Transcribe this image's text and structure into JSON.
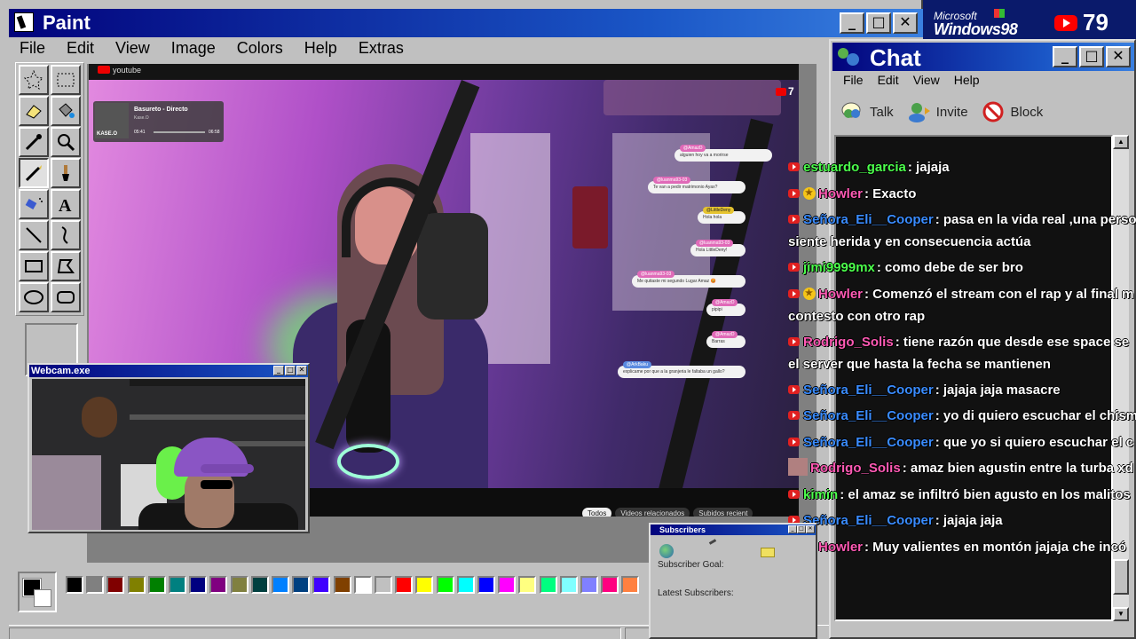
{
  "paint": {
    "title": "Paint",
    "menu": [
      "File",
      "Edit",
      "View",
      "Image",
      "Colors",
      "Help",
      "Extras"
    ],
    "palette": [
      "#000000",
      "#808080",
      "#800000",
      "#808000",
      "#008000",
      "#008080",
      "#000080",
      "#800080",
      "#808040",
      "#004040",
      "#0080ff",
      "#004080",
      "#4000ff",
      "#804000",
      "#ffffff",
      "#c0c0c0",
      "#ff0000",
      "#ffff00",
      "#00ff00",
      "#00ffff",
      "#0000ff",
      "#ff00ff",
      "#ffff80",
      "#00ff80",
      "#80ffff",
      "#8080ff",
      "#ff0080",
      "#ff8040"
    ]
  },
  "stream": {
    "yt_logo": "youtube",
    "music": {
      "song": "Basureto - Directo",
      "artist": "Kase.O",
      "cover": "KASE.O",
      "elapsed": "05:41",
      "total": "06:58"
    },
    "viewer_badge": "7",
    "yt_chat": [
      {
        "who": "@AmazD",
        "text": "alguien hoy va a morirse"
      },
      {
        "who": "@luanma93-03",
        "text": "Te van a pedir matrimonio Ayax?"
      },
      {
        "who": "@LittleDeny",
        "text": "Hola hola"
      },
      {
        "who": "@luanma93-03",
        "text": "Hola LittleDeny!"
      },
      {
        "who": "@luanma93-03",
        "text": "Me quitaste mi segundo Lugar Amaz 😡"
      },
      {
        "who": "@AmazD",
        "text": "pipipi"
      },
      {
        "who": "@AmazD",
        "text": "Barras"
      },
      {
        "who": "@ArkBaku",
        "text": "explicame por que a la granjeria le faltaba un gallo?"
      }
    ],
    "tabs": [
      "Todos",
      "Videos relacionados",
      "Subidos recient"
    ]
  },
  "webcam": {
    "title": "Webcam.exe"
  },
  "desktop": {
    "logo_top": "Microsoft",
    "logo_main": "Windows98",
    "viewer_count": "79"
  },
  "chat": {
    "title": "Chat",
    "menu": [
      "File",
      "Edit",
      "View",
      "Help"
    ],
    "toolbar": [
      "Talk",
      "Invite",
      "Block"
    ],
    "messages": [
      {
        "user": "estuardo_garcia",
        "text": ": jajaja",
        "color": "#4cff4c",
        "mod": false
      },
      {
        "user": "Howler",
        "text": ": Exacto",
        "color": "#ff5ab4",
        "mod": true
      },
      {
        "user": "Señora_Eli__Cooper",
        "text": ": pasa en la vida real ,una perso",
        "cont": "siente herida y en consecuencia actúa",
        "color": "#3a8cff",
        "mod": false
      },
      {
        "user": "jimi9999mx",
        "text": ": como debe de ser bro",
        "color": "#4cff4c",
        "mod": false
      },
      {
        "user": "Howler",
        "text": ": Comenzó el stream con el rap y al final m",
        "cont": "contesto con otro rap",
        "color": "#ff5ab4",
        "mod": true
      },
      {
        "user": "Rodrigo_Solis",
        "text": ": tiene razón que desde ese space se",
        "cont": "el server que hasta la fecha se mantienen",
        "color": "#ff5ab4",
        "mod": false
      },
      {
        "user": "Señora_Eli__Cooper",
        "text": ": jajaja jaja masacre",
        "color": "#3a8cff",
        "mod": false
      },
      {
        "user": "Señora_Eli__Cooper",
        "text": ": yo di quiero escuchar el chism",
        "color": "#3a8cff",
        "mod": false
      },
      {
        "user": "Señora_Eli__Cooper",
        "text": ": que yo si quiero escuchar el c",
        "color": "#3a8cff",
        "mod": false
      },
      {
        "user": "Rodrigo_Solis",
        "text": ": amaz bien agustin entre la turba xd",
        "color": "#ff5ab4",
        "mod": false,
        "avatar": true
      },
      {
        "user": "kimin",
        "text": ": el amaz se infiltró bien agusto en los malitos",
        "color": "#4cff4c",
        "mod": false
      },
      {
        "user": "Señora_Eli__Cooper",
        "text": ": jajaja jaja",
        "color": "#3a8cff",
        "mod": false
      },
      {
        "user": "Howler",
        "text": ": Muy valientes en montón jajaja che incó",
        "color": "#ff5ab4",
        "mod": true
      }
    ]
  },
  "subscribers": {
    "title": "Subscribers",
    "goal_label": "Subscriber Goal:",
    "latest_label": "Latest Subscribers:"
  }
}
